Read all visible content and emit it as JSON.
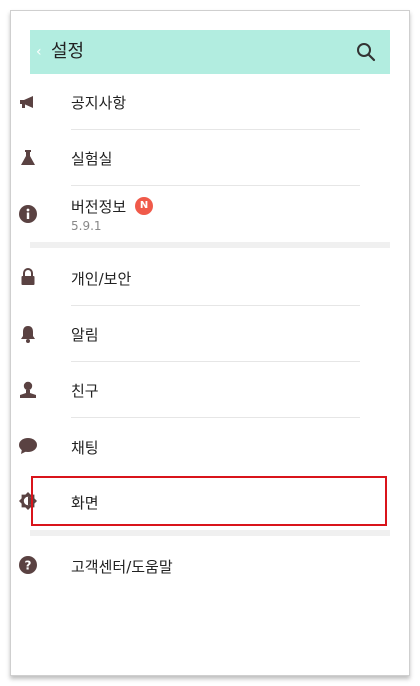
{
  "header": {
    "back_glyph": "‹",
    "title": "설정",
    "search_icon": "search-icon"
  },
  "items": [
    {
      "label": "공지사항",
      "icon": "megaphone-icon"
    },
    {
      "label": "실험실",
      "icon": "flask-icon"
    },
    {
      "label": "버전정보",
      "badge": "N",
      "sub": "5.9.1",
      "icon": "info-icon"
    },
    {
      "label": "개인/보안",
      "icon": "lock-icon"
    },
    {
      "label": "알림",
      "icon": "bell-icon"
    },
    {
      "label": "친구",
      "icon": "person-icon"
    },
    {
      "label": "채팅",
      "icon": "chat-bubble-icon"
    },
    {
      "label": "화면",
      "icon": "brightness-icon",
      "highlighted": true
    },
    {
      "label": "고객센터/도움말",
      "icon": "help-icon"
    }
  ],
  "colors": {
    "header_bg": "#b2ede0",
    "icon": "#5a4242",
    "highlight": "#d9141b",
    "badge": "#f05a4a"
  }
}
